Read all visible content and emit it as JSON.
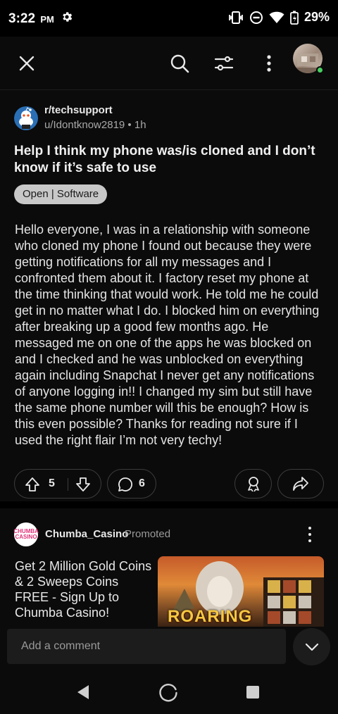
{
  "status_bar": {
    "time": "3:22",
    "ampm": "PM",
    "battery": "29%"
  },
  "post": {
    "subreddit": "r/techsupport",
    "author": "u/Idontknow2819",
    "age": "1h",
    "title": "Help I think my phone was/is cloned and I don’t know if it’s safe to use",
    "flair": "Open | Software",
    "body": "Hello everyone, I was in a relationship with someone who cloned my phone I found out because they were getting notifications for all my messages and I confronted them about it. I factory reset my phone at the time thinking that would work. He told me he could get in no matter what I do. I blocked him on everything after breaking up a good few months ago. He messaged me on one of the apps he was blocked on and I checked and he was unblocked on everything again including Snapchat I never get any notifications of anyone logging in!! I changed my sim but still have the same phone number will this be enough? How is this even possible? Thanks for reading not sure if I used the right flair I’m not very techy!",
    "votes": "5",
    "comments": "6"
  },
  "promoted": {
    "advertiser": "Chumba_Casino",
    "tag": "Promoted",
    "logo_text": "CHUMBA CASINO",
    "headline": "Get 2 Million Gold Coins & 2 Sweeps Coins FREE - Sign Up to Chumba Casino!",
    "image_text": "ROARING"
  },
  "comment_bar": {
    "placeholder": "Add a comment"
  },
  "colors": {
    "background": "#0b0b0b",
    "online": "#46d160",
    "snoo_bg": "#2a6fb5",
    "flair_bg": "#c8c8c8"
  }
}
